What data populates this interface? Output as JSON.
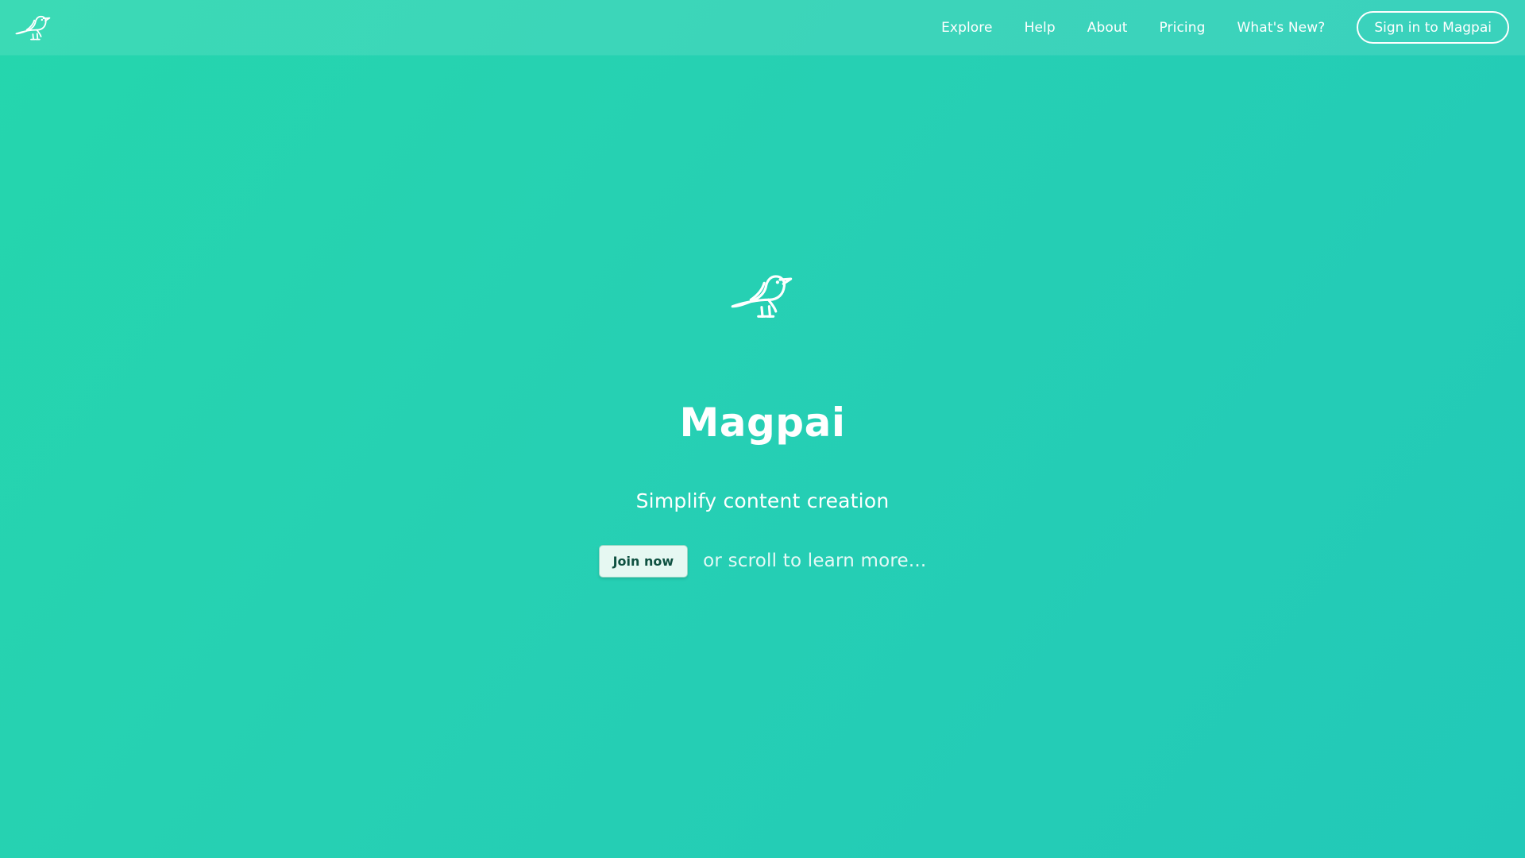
{
  "nav": {
    "logo_icon": "magpie-bird-icon",
    "links": [
      {
        "label": "Explore"
      },
      {
        "label": "Help"
      },
      {
        "label": "About"
      },
      {
        "label": "Pricing"
      },
      {
        "label": "What's New?"
      }
    ],
    "signin_label": "Sign in to Magpai"
  },
  "hero": {
    "logo_icon": "magpie-bird-icon",
    "title": "Magpai",
    "subtitle": "Simplify content creation",
    "join_label": "Join now",
    "scroll_hint": "or scroll to learn more..."
  },
  "colors": {
    "background_start": "#25d6ad",
    "background_end": "#22c9b8",
    "button_background": "#e6f8f2",
    "button_text": "#0f5141",
    "text": "#ffffff"
  }
}
